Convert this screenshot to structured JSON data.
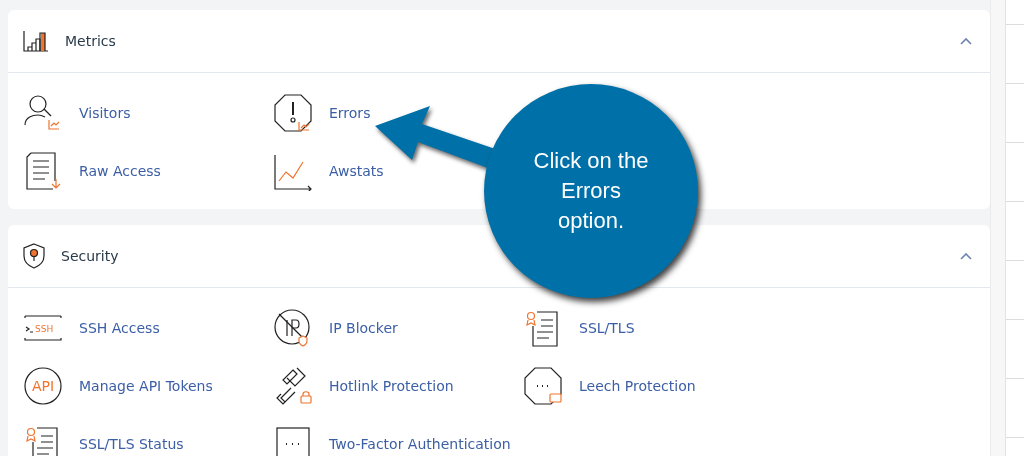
{
  "sections": [
    {
      "title": "Metrics",
      "expanded": true,
      "items": [
        {
          "label": "Visitors"
        },
        {
          "label": "Errors"
        },
        {
          "label": "Raw Access"
        },
        {
          "label": "Awstats"
        }
      ]
    },
    {
      "title": "Security",
      "expanded": true,
      "items": [
        {
          "label": "SSH Access",
          "icon_text": "SSH"
        },
        {
          "label": "IP Blocker"
        },
        {
          "label": "SSL/TLS"
        },
        {
          "label": "Manage API Tokens",
          "icon_text": "API"
        },
        {
          "label": "Hotlink Protection"
        },
        {
          "label": "Leech Protection"
        },
        {
          "label": "SSL/TLS Status"
        },
        {
          "label": "Two-Factor Authentication"
        }
      ]
    }
  ],
  "callout": {
    "text": "Click on the Errors option."
  }
}
